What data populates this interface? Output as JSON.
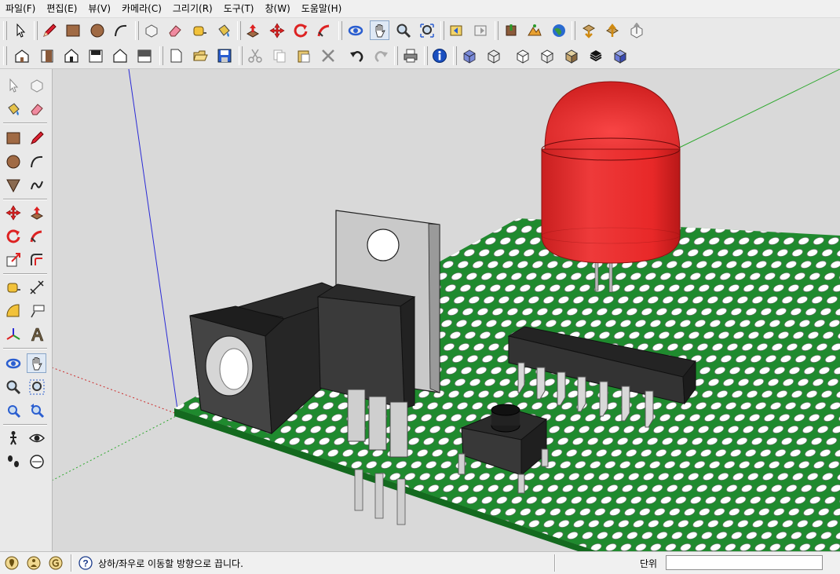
{
  "menu": {
    "items": [
      "파일(F)",
      "편집(E)",
      "뷰(V)",
      "카메라(C)",
      "그리기(R)",
      "도구(T)",
      "창(W)",
      "도움말(H)"
    ]
  },
  "status": {
    "hint": "상하/좌우로 이동할 방향으로 끕니다.",
    "measure_label": "단위",
    "measure_value": ""
  },
  "colors": {
    "board_green": "#1f8a2e",
    "led_red": "#ee2a2a",
    "component_dark": "#333333",
    "heatsink_gray": "#bdbdbd",
    "axis_blue": "#2a2ad6",
    "axis_green": "#2ea82e",
    "axis_red": "#cc2a2a"
  },
  "icons": {
    "toolbar_row1": [
      "select-icon",
      "pencil-icon",
      "rectangle-icon",
      "circle-icon",
      "arc-icon",
      "make-component-icon",
      "eraser-icon",
      "tape-measure-icon",
      "paint-bucket-icon",
      "push-pull-icon",
      "move-icon",
      "rotate-icon",
      "follow-me-icon",
      "orbit-icon",
      "pan-icon",
      "zoom-icon",
      "zoom-extents-icon",
      "previous-view-icon",
      "next-view-icon",
      "add-location-icon",
      "toggle-terrain-icon",
      "google-earth-icon",
      "get-models-icon",
      "share-model-icon",
      "share-component-icon"
    ],
    "toolbar_row2": [
      "iso-view-icon",
      "top-view-icon",
      "front-view-icon",
      "right-view-icon",
      "back-view-icon",
      "left-view-icon",
      "new-icon",
      "open-icon",
      "save-icon",
      "cut-icon",
      "copy-icon",
      "paste-icon",
      "delete-icon",
      "undo-icon",
      "redo-icon",
      "print-icon",
      "model-info-icon",
      "xray-icon",
      "wireframe-icon",
      "hidden-line-icon",
      "shaded-icon",
      "shaded-textures-icon",
      "monochrome-icon"
    ],
    "left_toolbar": [
      "select-icon",
      "make-component-icon",
      "paint-bucket-icon",
      "eraser-icon",
      "rectangle-icon",
      "line-icon",
      "circle-icon",
      "arc-icon",
      "polygon-icon",
      "freehand-icon",
      "move-icon",
      "push-pull-icon",
      "rotate-icon",
      "follow-me-icon",
      "scale-icon",
      "offset-icon",
      "tape-measure-icon",
      "dimension-icon",
      "protractor-icon",
      "text-icon",
      "axes-icon",
      "3d-text-icon",
      "orbit-icon",
      "pan-icon",
      "zoom-icon",
      "zoom-window-icon",
      "zoom-extents-icon",
      "previous-icon",
      "walk-icon",
      "look-around-icon",
      "footprints-icon",
      "section-plane-icon"
    ],
    "status": [
      "geo-location-icon",
      "credits-icon",
      "sketchup-logo-icon",
      "help-icon"
    ]
  }
}
